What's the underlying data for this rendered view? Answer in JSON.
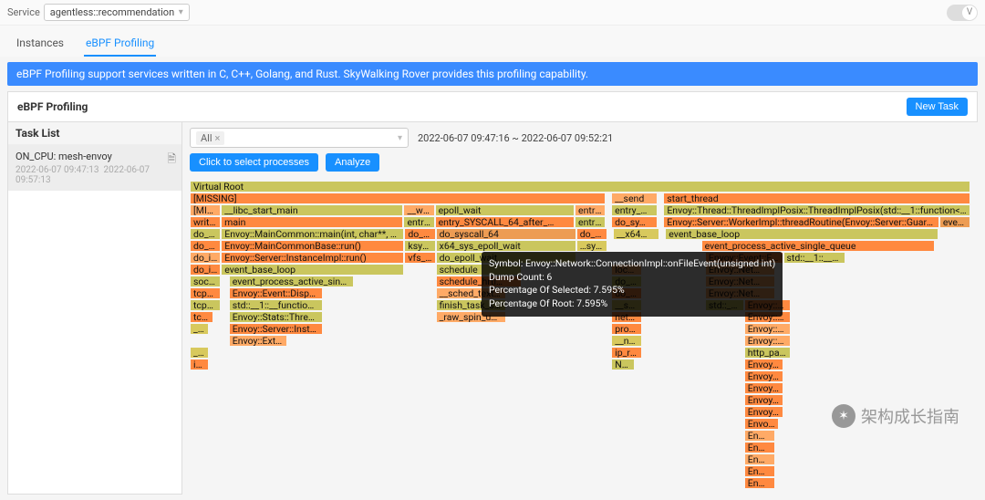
{
  "header": {
    "service_label": "Service",
    "service_value": "agentless::recommendation"
  },
  "tabs": {
    "instances": "Instances",
    "ebpf": "eBPF Profiling"
  },
  "banner": "eBPF Profiling support services written in C, C++, Golang, and Rust. SkyWalking Rover provides this profiling capability.",
  "section": {
    "title": "eBPF Profiling",
    "new_task": "New Task"
  },
  "tasklist": {
    "title": "Task List",
    "item_name": "ON_CPU: mesh-envoy",
    "item_date1": "2022-06-07 09:47:13",
    "item_date2": "2022-06-07 09:57:13"
  },
  "controls": {
    "all_tag": "All",
    "range": "2022-06-07 09:47:16 ~ 2022-06-07 09:52:21",
    "select_processes": "Click to select processes",
    "analyze": "Analyze"
  },
  "tooltip": {
    "l1": "Symbol: Envoy::Network::ConnectionImpl::onFileEvent(unsigned int)",
    "l2": "Dump Count: 6",
    "l3": "Percentage Of Selected: 7.595%",
    "l4": "Percentage Of Root: 7.595%"
  },
  "watermark": "架构成长指南",
  "flame": {
    "col1": {
      "r0": "Virtual Root",
      "r1": "[MISSING]",
      "r2a": "[MISS…",
      "r2b": "__libc_start_main",
      "r3a": "writev",
      "r3b": "main",
      "r4a": "do_writ…",
      "r4b": "Envoy::MainCommon::main(int, char**, std::__…",
      "r5a": "do_sy…",
      "r5b": "Envoy::MainCommonBase::run()",
      "r6a": "do_ite…",
      "r6b": "Envoy::Server::InstanceImpl::run()",
      "r7a": "do_ite…",
      "r7b": "event_base_loop",
      "r8a": "sock_…",
      "r8b": "event_process_active_single_…",
      "r9a": "tcp_se…",
      "r9b": "Envoy::Event::Dispat…",
      "r10a": "tcp_se…",
      "r10b": "std::__1::__function…",
      "r11a": "tcp_…",
      "r11b": "Envoy::Stats::Threa…",
      "r12a": "__t…",
      "r12b": "Envoy::Server::Insta…",
      "r13a": "",
      "r13b": "Envoy::Exte…",
      "r14a": "__i…",
      "r15a": "ip_…"
    },
    "col2": {
      "r2a": "__write",
      "r2b": "epoll_wait",
      "r3a": "entry_…",
      "r3b": "entry_SYSCALL_64_after_…",
      "r4a": "do_sy…",
      "r4b": "do_syscall_64",
      "r5a": "ksys_…",
      "r5b": "x64_sys_epoll_wait",
      "r6a": "vfs_…",
      "r6b": "do_epoll_wait",
      "r7": "schedule",
      "r8": "schedule_hrti…",
      "r9": "__sched_text…",
      "r10": "finish_task_s…",
      "r11": "_raw_spin_unl…"
    },
    "col3": {
      "r2": "entry_…",
      "r3": "entry_…",
      "r4": "do_sy…",
      "r5": "…sys…",
      "r6": "loca…",
      "r7": "do_so…",
      "r8": "do_so…",
      "r9": "__soft…",
      "r10": "net_rx…",
      "r11": "proces…",
      "r12": "__neti…",
      "r13": "ip_rcv",
      "r14": "NF…"
    },
    "colA": {
      "r1": "__send",
      "r2": "entry_…",
      "r3": "do_sy…",
      "r4": "__x64…"
    },
    "colB": {
      "r1": "start_thread",
      "r2": "Envoy::Thread::ThreadImplPosix::ThreadImplPosix(std::__1::function<void ()>, std::…",
      "r3a": "Envoy::Server::WorkerImpl::threadRoutine(Envoy::Server::GuardDog&)",
      "r3b": "eve…",
      "r4": "event_base_loop",
      "r5": "event_process_active_single_queue",
      "r6a": "Envoy::Event::Fil…",
      "r6b": "std::__1::__fu…",
      "r7": "Envoy::Net…",
      "r8": "Envoy::Net…",
      "r9": "Envoy::Net…",
      "r10a": "std::__1…",
      "r10b": "Envoy::H…",
      "r11": "Envoy::H…",
      "r12": "Envoy::H…",
      "r13": "Envoy::H…",
      "r14": "http_pars…",
      "r15": "Envoy…",
      "r16": "Envoy…",
      "r17": "Envoy…",
      "r18": "Envoy…",
      "r19": "Envoy…",
      "r20": "Envo…",
      "r21": "En…",
      "r22": "En…",
      "r23": "En…",
      "r24": "En…",
      "r25": "En…"
    }
  }
}
